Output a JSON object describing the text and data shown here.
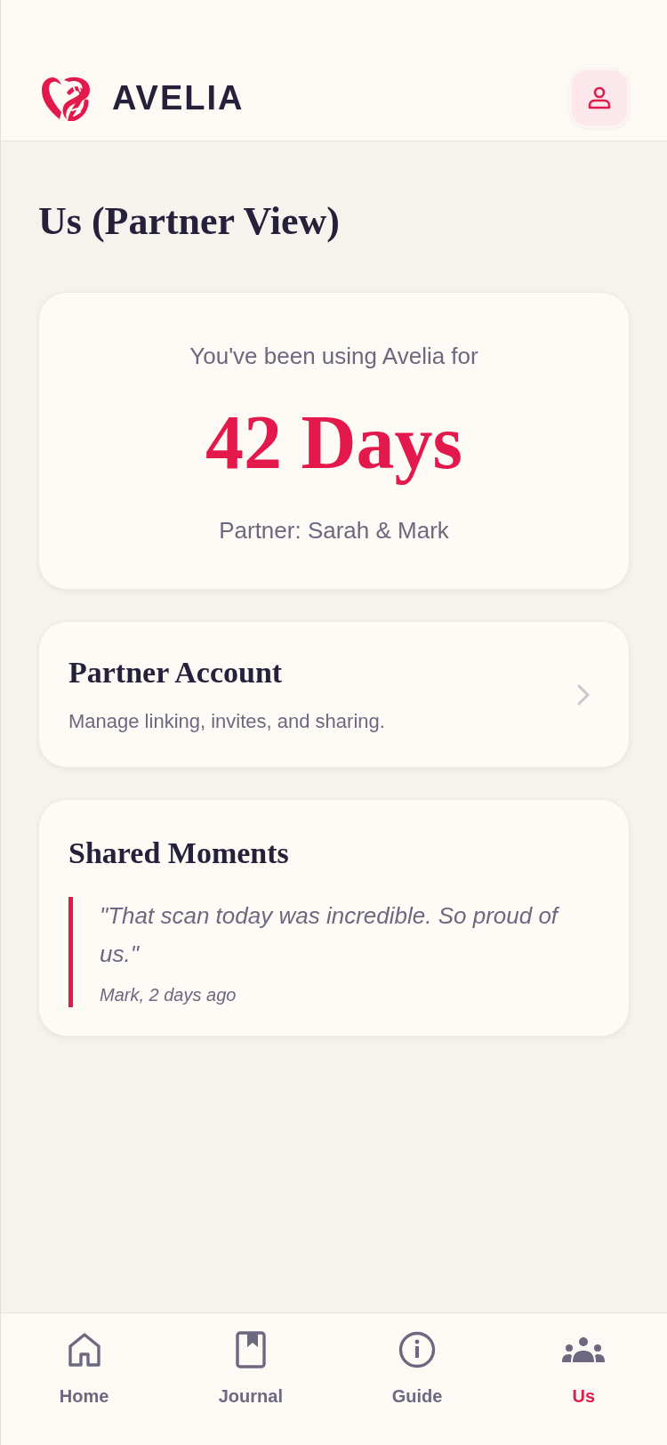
{
  "header": {
    "brand": "AVELIA"
  },
  "page_title": "Us (Partner View)",
  "usage_card": {
    "caption": "You've been using Avelia for",
    "days": "42 Days",
    "partner": "Partner: Sarah & Mark"
  },
  "partner_account": {
    "title": "Partner Account",
    "subtitle": "Manage linking, invites, and sharing."
  },
  "shared_moments": {
    "title": "Shared Moments",
    "moments": [
      {
        "quote": "\"That scan today was incredible. So proud of us.\"",
        "author": "Mark, 2 days ago"
      }
    ]
  },
  "bottom_nav": [
    {
      "kind": "home",
      "label": "Home",
      "selected": false
    },
    {
      "kind": "journal",
      "label": "Journal",
      "selected": false
    },
    {
      "kind": "guide",
      "label": "Guide",
      "selected": false
    },
    {
      "kind": "us",
      "label": "Us",
      "selected": true
    }
  ]
}
